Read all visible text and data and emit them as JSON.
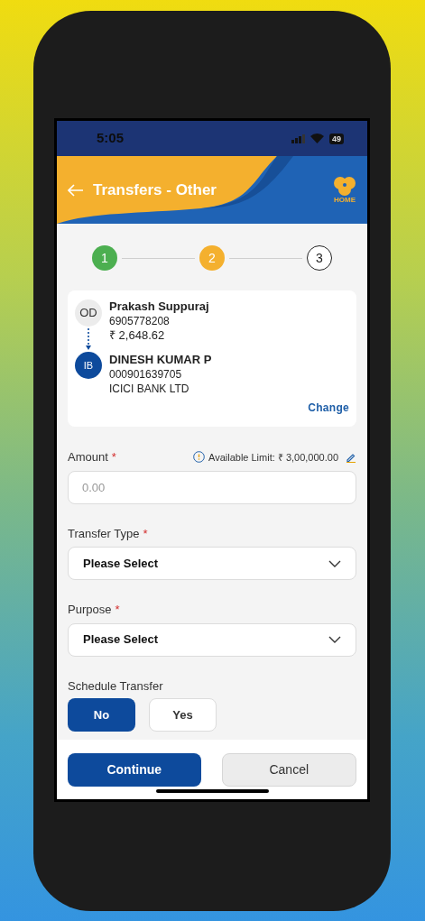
{
  "status_bar": {
    "time": "5:05",
    "battery": "49"
  },
  "header": {
    "title": "Transfers - Other",
    "home_label": "HOME"
  },
  "steps": [
    {
      "label": "1",
      "done": true,
      "selected": false
    },
    {
      "label": "2",
      "done": false,
      "selected": true
    },
    {
      "label": "3",
      "done": false,
      "selected": false
    }
  ],
  "transfer_card": {
    "from": {
      "badge": "OD",
      "name": "Prakash Suppuraj",
      "account": "6905778208",
      "balance": "₹ 2,648.62"
    },
    "to": {
      "badge": "IB",
      "name": "DINESH KUMAR P",
      "account": "000901639705",
      "bank": "ICICI BANK LTD"
    },
    "change_link": "Change"
  },
  "amount": {
    "label": "Amount",
    "required_mark": "*",
    "limit": "Available Limit: ₹ 3,00,000.00",
    "placeholder": "0.00"
  },
  "transfer_type": {
    "label": "Transfer Type",
    "required_mark": "*",
    "value": "Please Select"
  },
  "purpose": {
    "label": "Purpose",
    "required_mark": "*",
    "value": "Please Select"
  },
  "schedule_transfer": {
    "label": "Schedule Transfer",
    "options": [
      {
        "label": "No",
        "selected": true
      },
      {
        "label": "Yes",
        "selected": false
      }
    ]
  },
  "footer_buttons": [
    {
      "label": "Continue",
      "kind": "primary"
    },
    {
      "label": "Cancel",
      "kind": "secondary"
    }
  ]
}
